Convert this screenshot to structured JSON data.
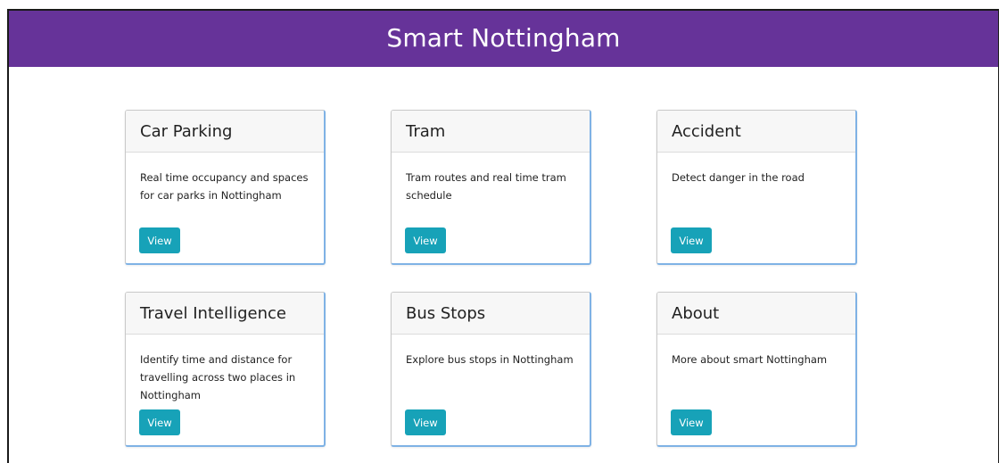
{
  "header": {
    "title": "Smart Nottingham"
  },
  "cards": [
    {
      "title": "Car Parking",
      "description": "Real time occupancy and spaces for car parks in Nottingham",
      "button": "View"
    },
    {
      "title": "Tram",
      "description": "Tram routes and real time tram schedule",
      "button": "View"
    },
    {
      "title": "Accident",
      "description": "Detect danger in the road",
      "button": "View"
    },
    {
      "title": "Travel Intelligence",
      "description": "Identify time and distance for travelling across two places in Nottingham",
      "button": "View"
    },
    {
      "title": "Bus Stops",
      "description": "Explore bus stops in Nottingham",
      "button": "View"
    },
    {
      "title": "About",
      "description": "More about smart Nottingham",
      "button": "View"
    }
  ],
  "colors": {
    "header_bg": "#663399",
    "button_bg": "#17a2b8",
    "card_accent": "#7fb2e5"
  }
}
